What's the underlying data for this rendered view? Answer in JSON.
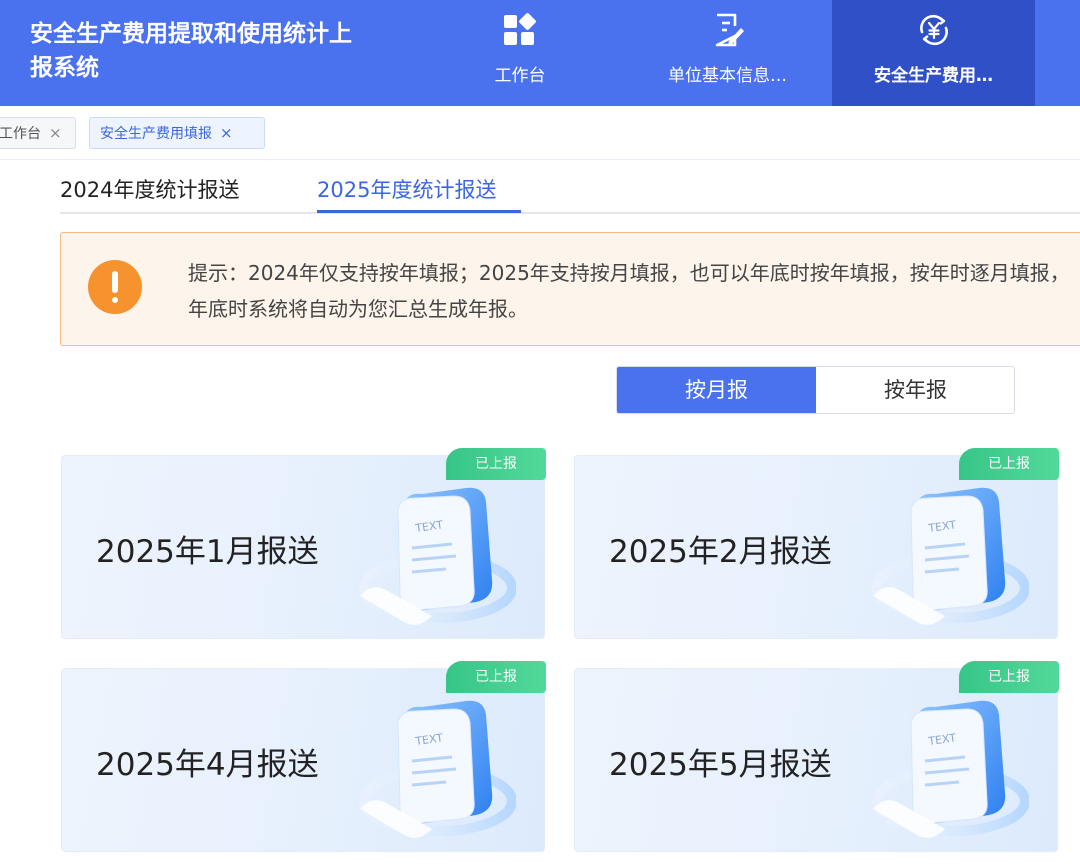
{
  "header": {
    "app_title": "安全生产费用提取和使用统计上报系统",
    "nav": [
      {
        "label": "工作台",
        "icon": "grid-apps-icon"
      },
      {
        "label": "单位基本信息…",
        "icon": "document-edit-icon"
      },
      {
        "label": "安全生产费用…",
        "icon": "yuan-exchange-icon"
      }
    ]
  },
  "page_tabs": [
    {
      "label": "工作台"
    },
    {
      "label": "安全生产费用填报"
    }
  ],
  "close_glyph": "×",
  "year_tabs": [
    {
      "label": "2024年度统计报送"
    },
    {
      "label": "2025年度统计报送"
    }
  ],
  "notice": {
    "text": "提示：2024年仅支持按年填报；2025年支持按月填报，也可以年底时按年填报，按年时逐月填报，年底时系统将自动为您汇总生成年报。"
  },
  "segmented": {
    "options": [
      "按月报",
      "按年报"
    ],
    "selected": "按月报"
  },
  "cards": [
    {
      "title": "2025年1月报送",
      "status": "已上报"
    },
    {
      "title": "2025年2月报送",
      "status": "已上报"
    },
    {
      "title": "2025年4月报送",
      "status": "已上报"
    },
    {
      "title": "2025年5月报送",
      "status": "已上报"
    }
  ],
  "colors": {
    "header_bg": "#4a72ee",
    "nav_active_bg": "#2f50c6",
    "accent": "#3b66e0",
    "warning": "#f7932e",
    "status_green": "#37c588"
  }
}
